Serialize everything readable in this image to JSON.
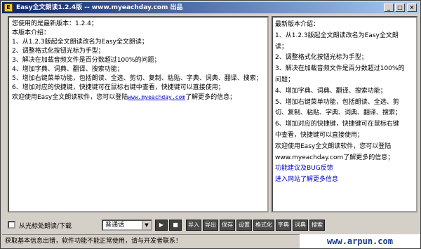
{
  "window": {
    "title": "Easy全文朗读1.2.4版 -- www.myeachday.com 出品",
    "controls": {
      "minimize": "_",
      "maximize": "□",
      "close": "×"
    }
  },
  "left_panel": {
    "lines": [
      "您使用的是最新版本：1.2.4；",
      "本版本介绍：",
      "1、从1.2.3版起全文朗读改名为Easy全文朗读；",
      "2、调整格式化按钮光标为手型；",
      "3、解决在加载音频文件是百分数超过100%的问题；",
      "4、增加字典、词典、翻译、搜索功能；",
      "5、增加右键菜单功能，包括朗读、全选、剪切、复制、粘贴、字典、词典、翻译、搜索；",
      "6、增加对应的快捷键，快捷键可在鼠标右键中查看，快捷键可以直接使用；"
    ],
    "last_line_prefix": "欢迎使用Easy全文朗读软件，您可以登陆",
    "last_line_link": "www.myeachday.com",
    "last_line_suffix": "了解更多的信息；"
  },
  "right_panel": {
    "lines": [
      "最新版本介绍：",
      "1、从1.2.3版起全文朗读改名为Easy全文朗",
      "读；",
      "2、调整格式化按钮光标为手型；",
      "3、解决在加载音频文件是百分数超过100%的",
      "问题；",
      "4、增加字典、词典、翻译、搜索功能；",
      "5、增加右键菜单功能，包括朗读、全选、剪",
      "切、复制、粘贴、字典、词典、翻译、搜索；",
      "6、增加对应的快捷键，快捷键可在鼠标右键",
      "中查看，快捷键可以直接使用；",
      "欢迎使用Easy全文朗读软件，您可以登陆",
      "www.myeachday.com了解更多的信息；"
    ],
    "links": [
      "功能建议及BUG反馈",
      "进入网站了解更多信息"
    ]
  },
  "controls": {
    "checkbox_label": "从光标处朗读/下载",
    "voice_select": "普通话",
    "play_icon": "play-icon",
    "stop_icon": "stop-icon",
    "buttons": [
      "导入",
      "导出",
      "保存",
      "设置",
      "格式化",
      "字典",
      "词典",
      "搜索"
    ]
  },
  "status": {
    "text": "获取基本信息出错，软件功能不能正常使用，请与开发者联系！"
  },
  "watermark": "www.arpun.com"
}
